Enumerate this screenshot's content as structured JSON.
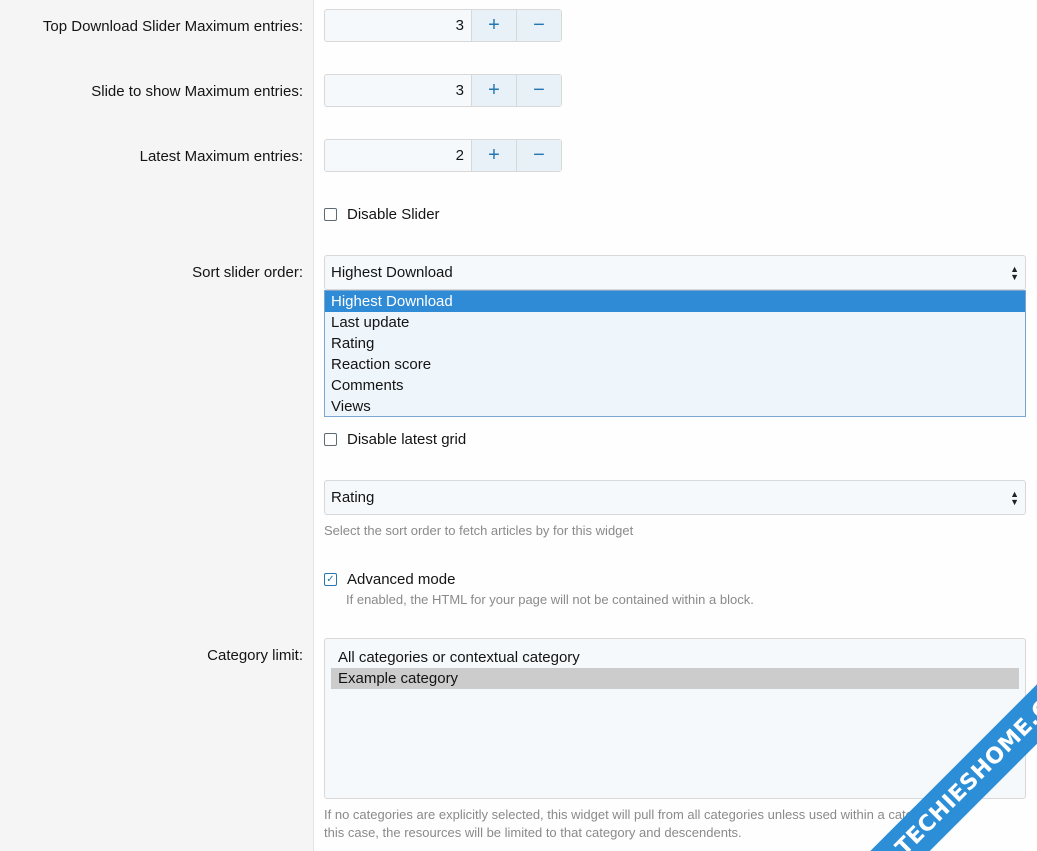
{
  "labels": {
    "top_download": "Top Download Slider Maximum entries:",
    "slide_to_show": "Slide to show Maximum entries:",
    "latest": "Latest Maximum entries:",
    "sort_slider": "Sort slider order:",
    "category_limit": "Category limit:"
  },
  "fields": {
    "top_download_value": "3",
    "slide_to_show_value": "3",
    "latest_value": "2",
    "plus": "+",
    "minus": "−"
  },
  "checkboxes": {
    "disable_slider": {
      "label": "Disable Slider",
      "checked": false
    },
    "disable_latest_grid": {
      "label": "Disable latest grid",
      "checked": false
    },
    "advanced_mode": {
      "label": "Advanced mode",
      "checked": true,
      "check_glyph": "✓"
    }
  },
  "sort_slider": {
    "selected": "Highest Download",
    "options": [
      "Highest Download",
      "Last update",
      "Rating",
      "Reaction score",
      "Comments",
      "Views"
    ],
    "highlighted_index": 0
  },
  "sort_order": {
    "selected": "Rating",
    "hint": "Select the sort order to fetch articles by for this widget"
  },
  "advanced_hint": "If enabled, the HTML for your page will not be contained within a block.",
  "category_limit": {
    "options": [
      "All categories or contextual category",
      "Example category"
    ],
    "selected_index": 1
  },
  "footnote": {
    "line1": "If no categories are explicitly selected, this widget will pull from all categories unless used within a category. In",
    "line2": "this case, the resources will be limited to that category and descendents."
  },
  "watermark": "TECHIESHOME.COM",
  "colors": {
    "accent": "#2577b1",
    "highlight": "#2f8bd6",
    "watermark": "#2b8ed7"
  }
}
